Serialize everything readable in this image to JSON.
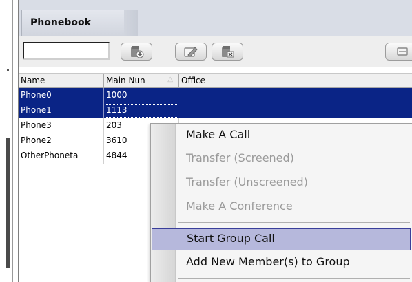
{
  "panel": {
    "title": "Phonebook"
  },
  "search": {
    "value": ""
  },
  "toolbar": {
    "icons": [
      "add-contact-icon",
      "edit-contact-icon",
      "delete-contact-icon",
      "more-icon"
    ]
  },
  "table": {
    "columns": [
      "Name",
      "Main Nun",
      "Office"
    ],
    "sort_column": "Main Nun",
    "sort_direction": "ascending",
    "rows": [
      {
        "name": "Phone0",
        "main": "1000",
        "office": "",
        "selected": true
      },
      {
        "name": "Phone1",
        "main": "1113",
        "office": "",
        "selected": true
      },
      {
        "name": "Phone3",
        "main": "203",
        "office": "",
        "selected": false
      },
      {
        "name": "Phone2",
        "main": "3610",
        "office": "",
        "selected": false
      },
      {
        "name": "OtherPhoneta",
        "main": "4844",
        "office": "",
        "selected": false
      }
    ]
  },
  "context_menu": {
    "items": [
      {
        "label": "Make A Call",
        "enabled": true
      },
      {
        "label": "Transfer (Screened)",
        "enabled": false
      },
      {
        "label": "Transfer (Unscreened)",
        "enabled": false
      },
      {
        "label": "Make A Conference",
        "enabled": false
      },
      {
        "label": "Start Group Call",
        "enabled": true,
        "highlighted": true
      },
      {
        "label": "Add New Member(s) to Group",
        "enabled": true
      }
    ]
  },
  "colors": {
    "selection": "#0a2486",
    "menu_highlight": "#b6b8dc",
    "menu_highlight_border": "#3a3e9a",
    "disabled_text": "#9a9a9a"
  }
}
